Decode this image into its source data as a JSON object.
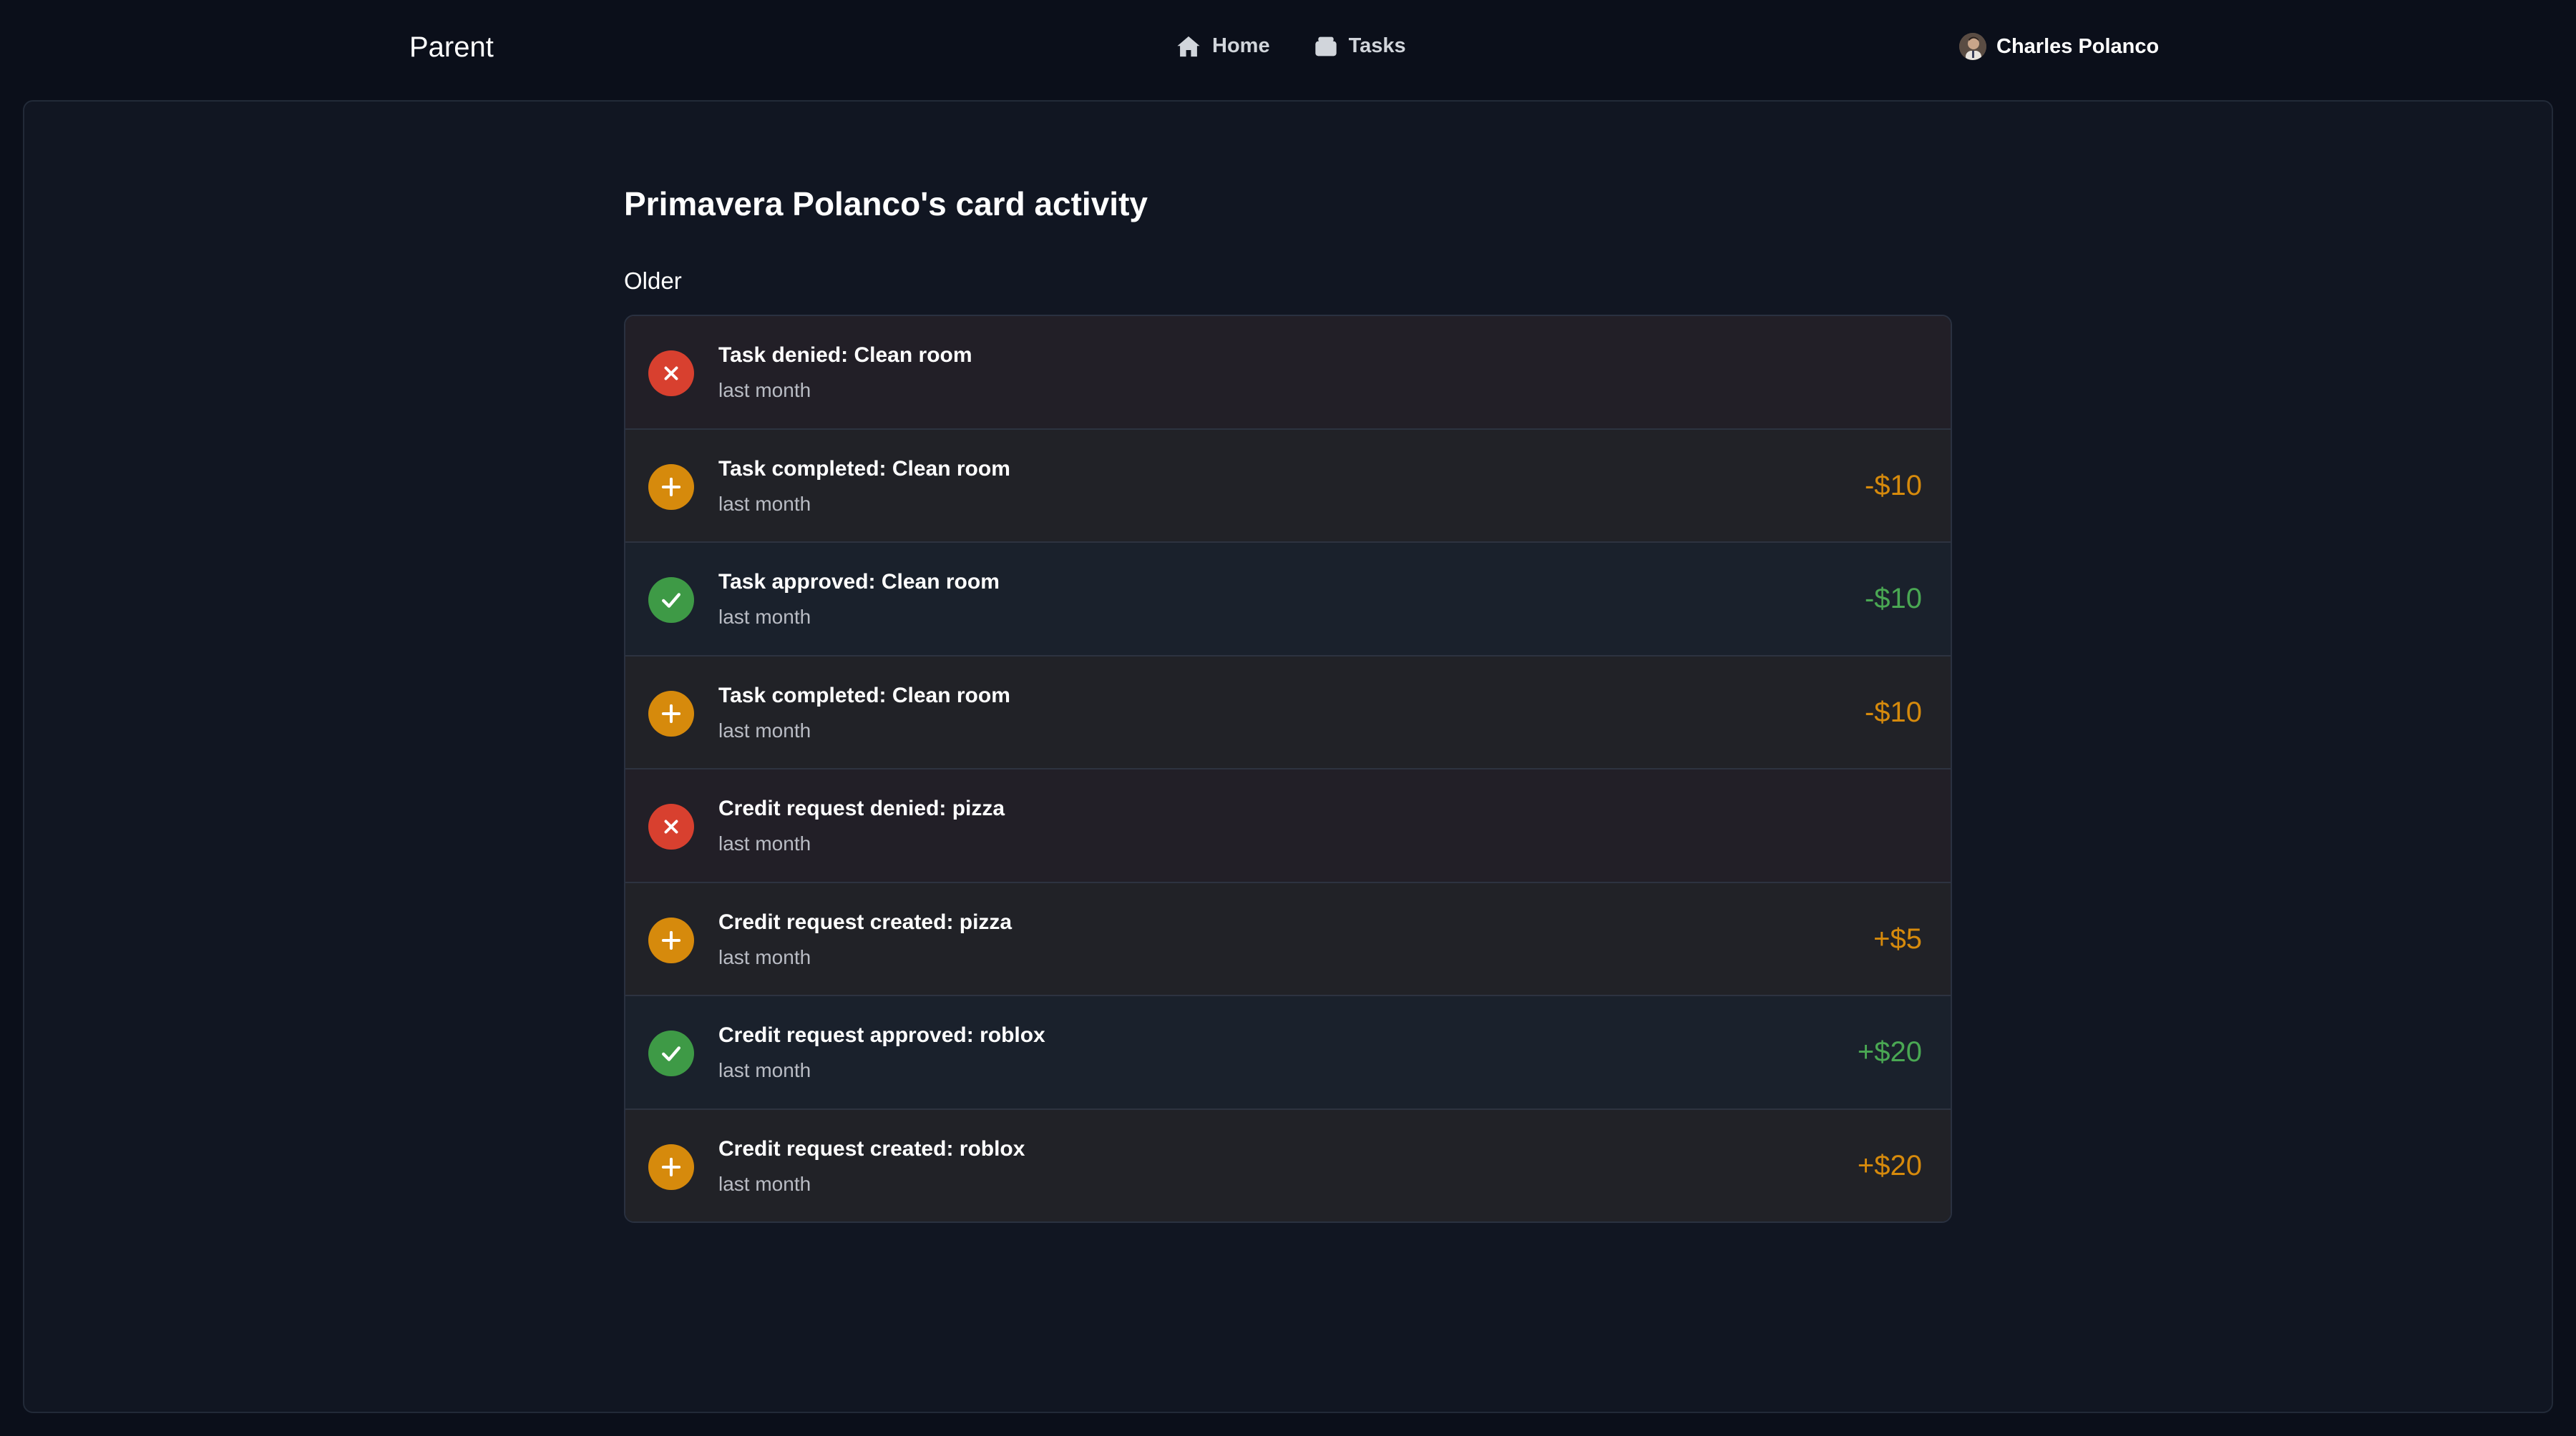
{
  "header": {
    "brand": "Parent",
    "nav": [
      {
        "label": "Home",
        "icon": "home-icon"
      },
      {
        "label": "Tasks",
        "icon": "tasks-icon"
      }
    ],
    "user_name": "Charles Polanco"
  },
  "page": {
    "title": "Primavera Polanco's card activity",
    "section_label": "Older"
  },
  "colors": {
    "denied": "#d8402f",
    "pending": "#d68a0c",
    "approved": "#3e9a46"
  },
  "activities": [
    {
      "title": "Task denied: Clean room",
      "time": "last month",
      "status": "denied",
      "amount": ""
    },
    {
      "title": "Task completed: Clean room",
      "time": "last month",
      "status": "pending",
      "amount": "-$10"
    },
    {
      "title": "Task approved: Clean room",
      "time": "last month",
      "status": "approved",
      "amount": "-$10"
    },
    {
      "title": "Task completed: Clean room",
      "time": "last month",
      "status": "pending",
      "amount": "-$10"
    },
    {
      "title": "Credit request denied: pizza",
      "time": "last month",
      "status": "denied",
      "amount": ""
    },
    {
      "title": "Credit request created: pizza",
      "time": "last month",
      "status": "pending",
      "amount": "+$5"
    },
    {
      "title": "Credit request approved: roblox",
      "time": "last month",
      "status": "approved",
      "amount": "+$20"
    },
    {
      "title": "Credit request created: roblox",
      "time": "last month",
      "status": "pending",
      "amount": "+$20"
    }
  ]
}
